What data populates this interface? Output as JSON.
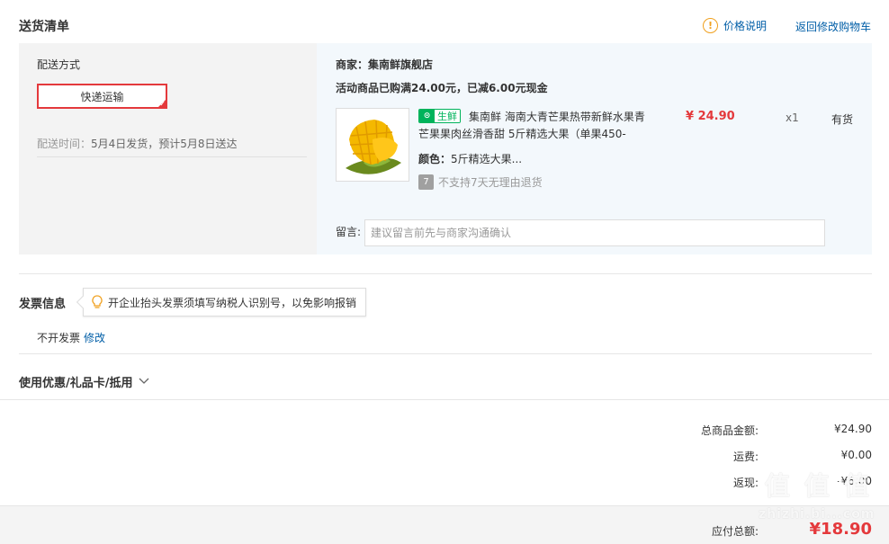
{
  "header": {
    "title": "送货清单",
    "price_note": "价格说明",
    "back_to_cart": "返回修改购物车"
  },
  "shipping": {
    "label": "配送方式",
    "method": "快递运输",
    "time_label": "配送时间：",
    "time_value": "5月4日发货，预计5月8日送达"
  },
  "merchant": {
    "label": "商家：",
    "name": "集南鲜旗舰店",
    "promo": "活动商品已购满24.00元，已减6.00元现金"
  },
  "product": {
    "tag_text": "生鲜",
    "title": "集南鲜 海南大青芒果热带新鲜水果青芒果果肉丝滑香甜 5斤精选大果（单果450-",
    "color_label": "颜色：",
    "color_value": "5斤精选大果...",
    "no_return": "不支持7天无理由退货",
    "price": "¥ 24.90",
    "quantity": "x1",
    "stock": "有货"
  },
  "remark": {
    "label": "留言:",
    "placeholder": "建议留言前先与商家沟通确认"
  },
  "invoice": {
    "title": "发票信息",
    "tip": "开企业抬头发票须填写纳税人识别号，以免影响报销",
    "status": "不开发票",
    "edit": "修改"
  },
  "coupon": {
    "label": "使用优惠/礼品卡/抵用"
  },
  "summary": {
    "items": [
      {
        "label": "总商品金额:",
        "value": "¥24.90"
      },
      {
        "label": "运费:",
        "value": "¥0.00"
      },
      {
        "label": "返现:",
        "value": "-¥6.00"
      }
    ],
    "total_label": "应付总额:",
    "total_value": "¥18.90"
  },
  "watermark": {
    "glyph": "值",
    "text": "zhizhi.bi...com"
  },
  "colors": {
    "accent_red": "#e4393c",
    "link_blue": "#005ea7",
    "fresh_green": "#00b35b",
    "warn_orange": "#f0a01e"
  },
  "icons": {
    "price_note": "info-circle-icon",
    "tip": "lightbulb-icon",
    "no_return": "no-return-7-icon",
    "coupon_toggle": "chevron-down-icon"
  }
}
